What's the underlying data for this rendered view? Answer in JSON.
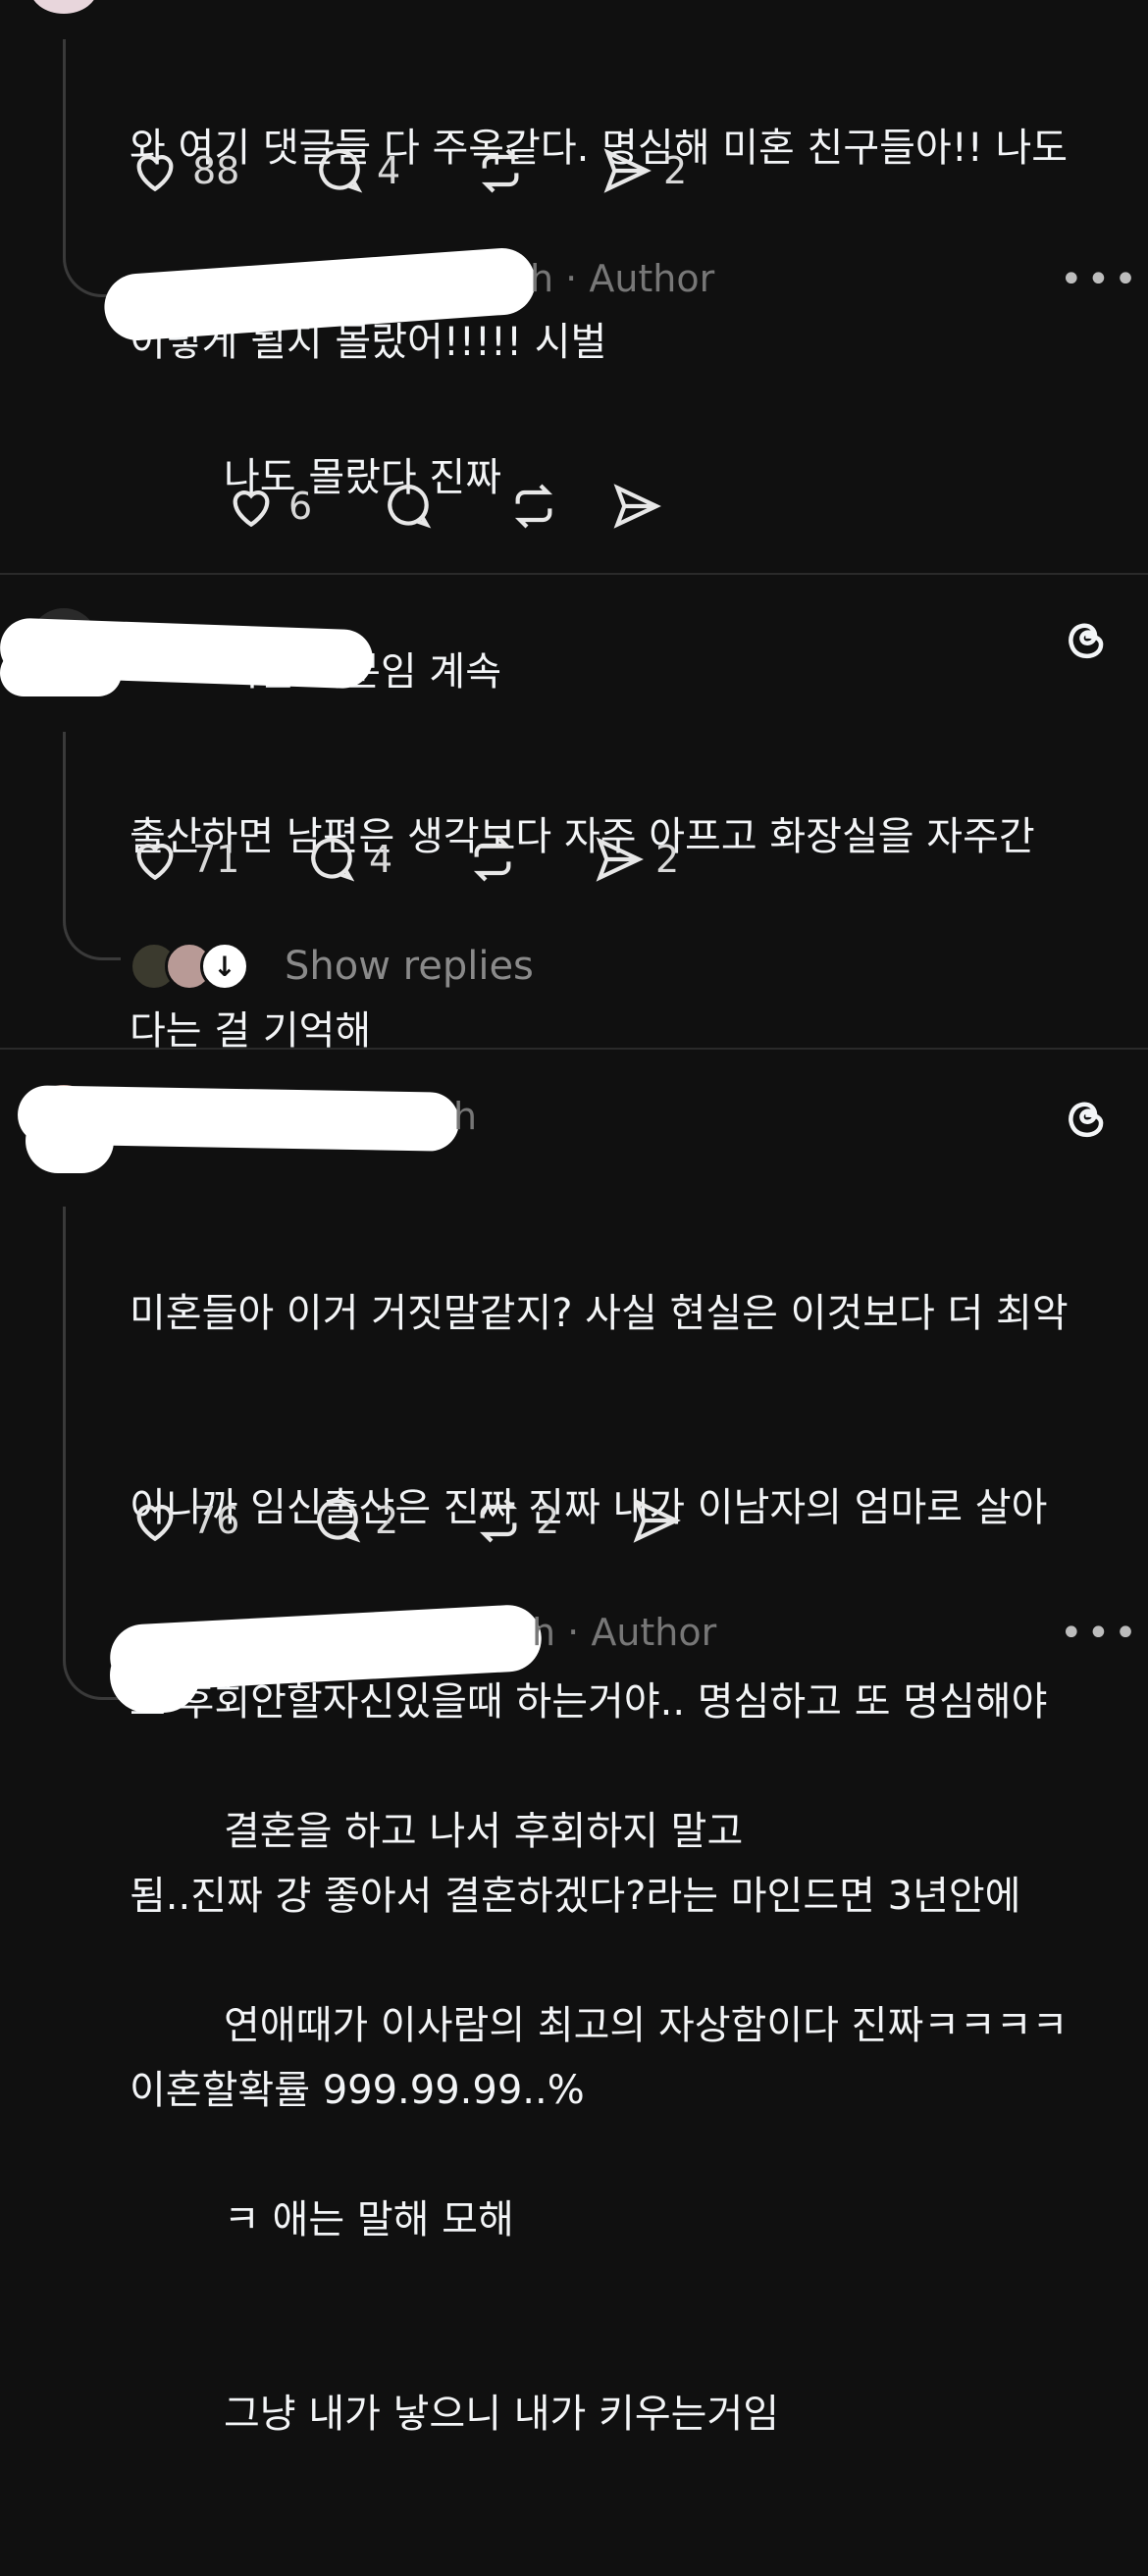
{
  "posts": [
    {
      "lines": [
        "와 여기 댓글들 다 주옥같다. 명심해 미혼 친구들아!! 나도",
        "이렇게 될지 몰랐어!!!!! 시벌"
      ],
      "likes": "88",
      "comments": "4",
      "reposts": "",
      "shares": "2",
      "reply": {
        "meta": "h · Author",
        "lines": [
          "나도 몰랐다 진짜",
          "속은 기분임 계속"
        ],
        "likes": "6"
      }
    },
    {
      "lines": [
        "출산하면 남편은 생각보다 자주 아프고 화장실을 자주간",
        "다는 걸 기억해"
      ],
      "likes": "71",
      "comments": "4",
      "reposts": "",
      "shares": "2",
      "show_replies": "Show replies"
    },
    {
      "meta": "h",
      "lines": [
        "미혼들아 이거 거짓말같지? 사실 현실은 이것보다 더 최악",
        "이니까 임신출산은 진짜 진짜 내가 이남자의 엄마로 살아",
        "도 후회안할자신있을때 하는거야.. 명심하고 또 명심해야",
        "됨..진짜 걍 좋아서 결혼하겠다?라는 마인드면 3년안에",
        "이혼할확률 999.99.99..%"
      ],
      "likes": "76",
      "comments": "2",
      "reposts": "2",
      "shares": "",
      "reply": {
        "meta": "h · Author",
        "lines": [
          "결혼을 하고 나서 후회하지 말고",
          "연애때가 이사람의 최고의 자상함이다 진짜ㅋㅋㅋㅋ",
          "ㅋ 애는 말해 모해",
          "그냥 내가 낳으니 내가 키우는거임"
        ]
      }
    }
  ],
  "icons": {
    "like": "heart-icon",
    "comment": "comment-icon",
    "repost": "repost-icon",
    "share": "share-icon",
    "more": "more-icon",
    "threads": "threads-logo-icon"
  },
  "colors": {
    "background": "#101010",
    "text": "#f3f5f7",
    "muted": "#777777"
  }
}
